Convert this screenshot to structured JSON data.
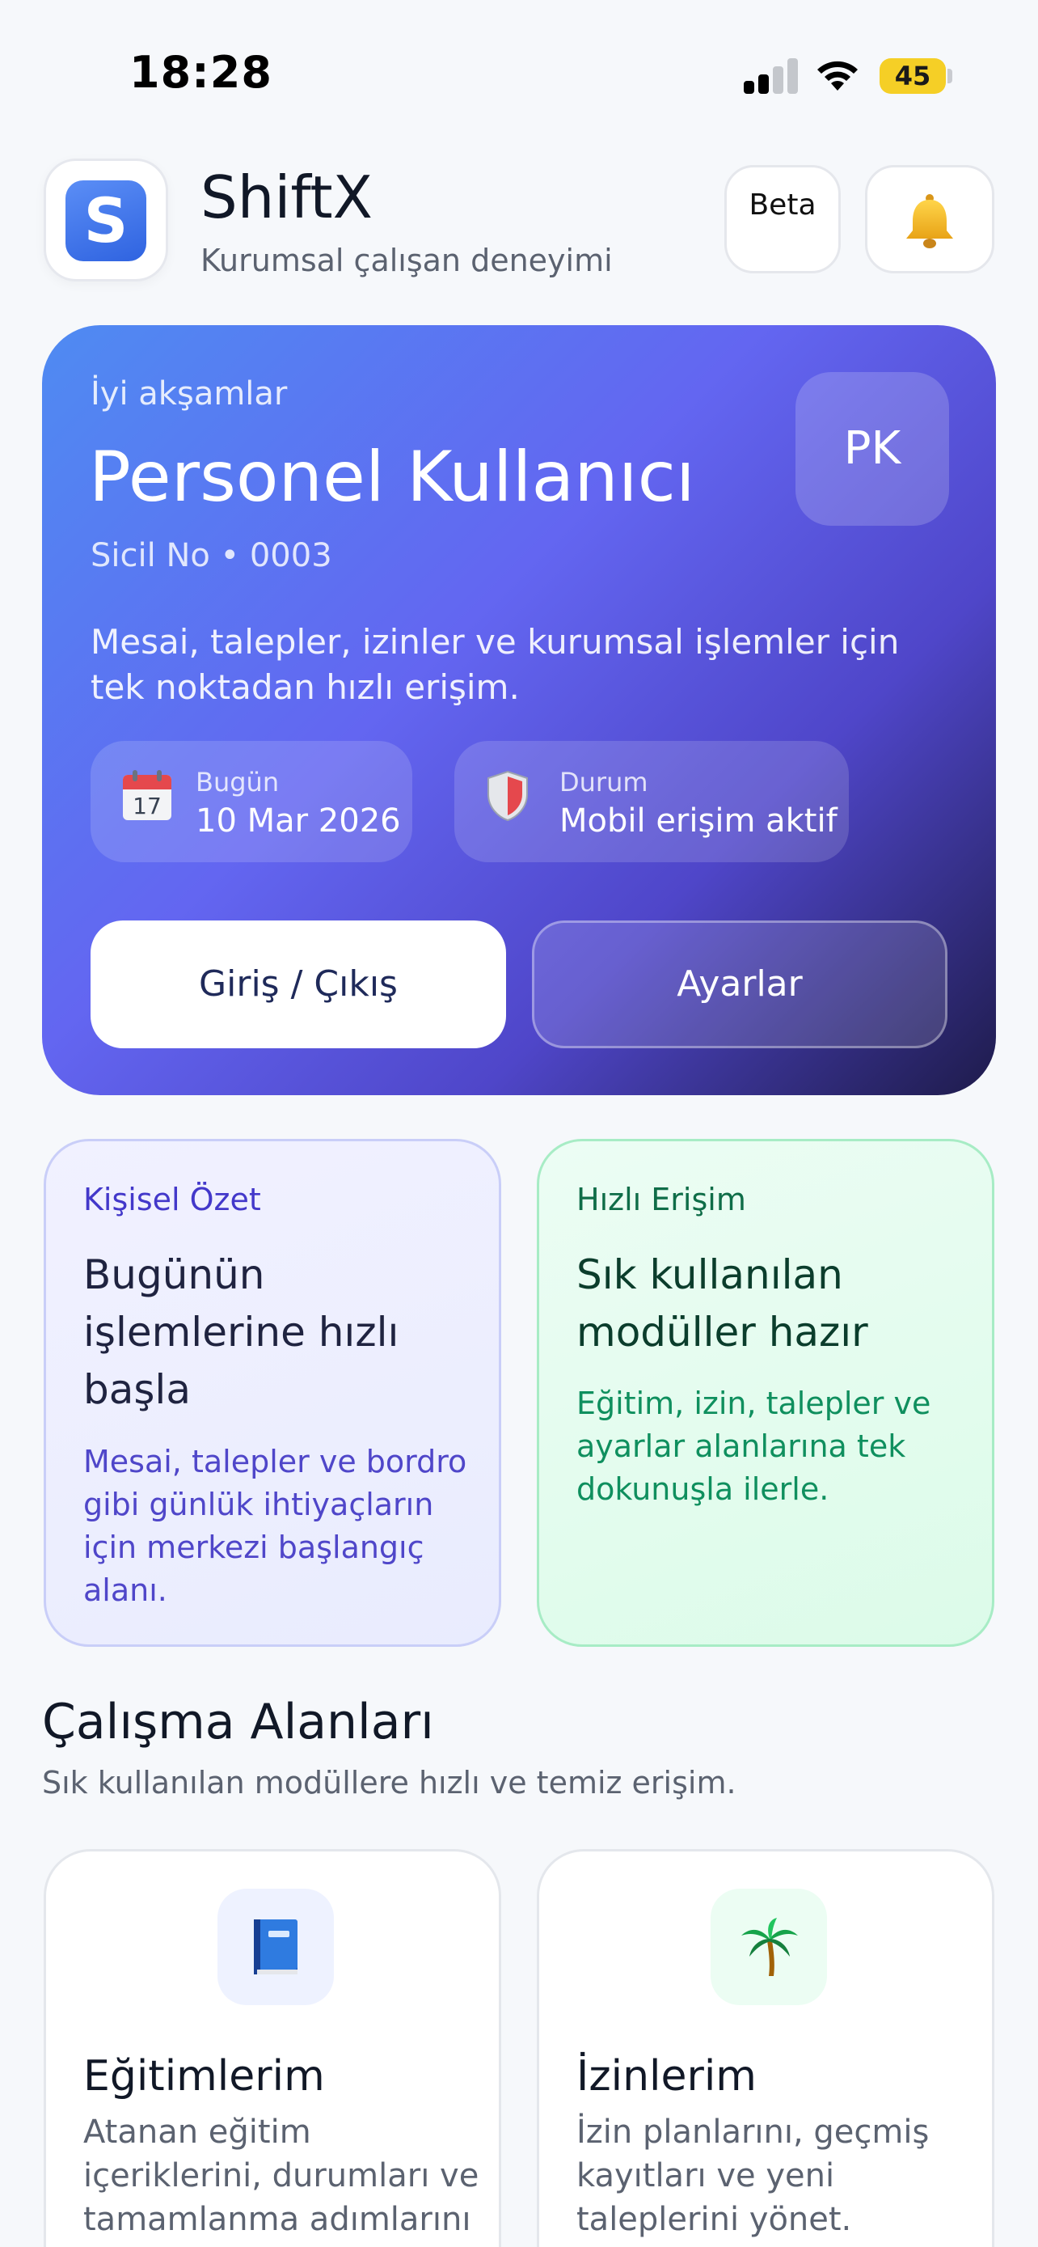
{
  "status_bar": {
    "time": "18:28",
    "battery": "45"
  },
  "header": {
    "logo_letter": "S",
    "title": "ShiftX",
    "subtitle": "Kurumsal çalışan deneyimi",
    "beta_label": "Beta"
  },
  "hero": {
    "greeting": "İyi akşamlar",
    "name": "Personel Kullanıcı",
    "employee_id": "Sicil No • 0003",
    "avatar_initials": "PK",
    "description": "Mesai, talepler, izinler ve kurumsal işlemler için tek noktadan hızlı erişim.",
    "today_label": "Bugün",
    "today_value": "10 Mar 2026",
    "calendar_day": "17",
    "status_label": "Durum",
    "status_value": "Mobil erişim aktif",
    "primary_button": "Giriş / Çıkış",
    "secondary_button": "Ayarlar"
  },
  "summary_cards": {
    "personal": {
      "eyebrow": "Kişisel Özet",
      "title": "Bugünün işlemlerine hızlı başla",
      "description": "Mesai, talepler ve bordro gibi günlük ihtiyaçların için merkezi başlangıç alanı."
    },
    "quick": {
      "eyebrow": "Hızlı Erişim",
      "title": "Sık kullanılan modüller hazır",
      "description": "Eğitim, izin, talepler ve ayarlar alanlarına tek dokunuşla ilerle."
    }
  },
  "section": {
    "title": "Çalışma Alanları",
    "subtitle": "Sık kullanılan modüllere hızlı ve temiz erişim."
  },
  "modules": [
    {
      "title": "Eğitimlerim",
      "description": "Atanan eğitim içeriklerini, durumları ve tamamlanma adımlarını izle.",
      "icon": "book-icon"
    },
    {
      "title": "İzinlerim",
      "description": "İzin planlarını, geçmiş kayıtları ve yeni taleplerini yönet.",
      "icon": "palm-tree-icon"
    }
  ],
  "colors": {
    "hero_start": "#4f8bf2",
    "hero_mid": "#6366f1",
    "hero_end": "#1e1b4b",
    "personal_accent": "#4f46c9",
    "quick_accent": "#0f8f5e",
    "battery": "#f5cf26"
  }
}
